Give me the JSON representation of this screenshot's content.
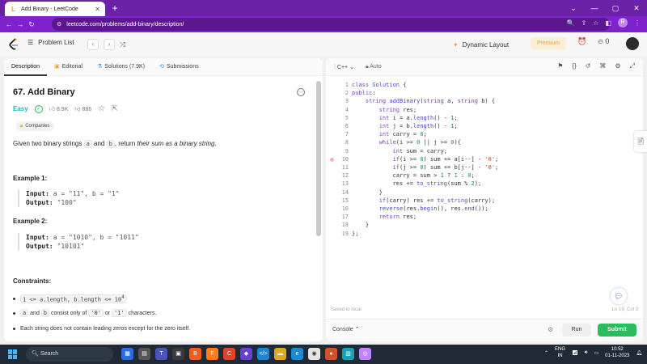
{
  "browser": {
    "tab_title": "Add Binary - LeetCode",
    "url": "leetcode.com/problems/add-binary/description/",
    "profile_initial": "R"
  },
  "header": {
    "problem_list": "Problem List",
    "dynamic_layout": "Dynamic Layout",
    "premium": "Premium",
    "streak": "0"
  },
  "left_tabs": [
    "Description",
    "Editorial",
    "Solutions (7.9K)",
    "Submissions"
  ],
  "problem": {
    "title": "67. Add Binary",
    "difficulty": "Easy",
    "likes": "8.9K",
    "dislikes": "886",
    "companies": "Companies",
    "desc_pre": "Given two binary strings ",
    "desc_a": "a",
    "desc_and": " and ",
    "desc_b": "b",
    "desc_mid": ", return ",
    "desc_em": "their sum as a binary string",
    "desc_end": "."
  },
  "examples": [
    {
      "heading": "Example 1:",
      "input_label": "Input:",
      "input": "a = \"11\", b = \"1\"",
      "output_label": "Output:",
      "output": "\"100\""
    },
    {
      "heading": "Example 2:",
      "input_label": "Input:",
      "input": "a = \"1010\", b = \"1011\"",
      "output_label": "Output:",
      "output": "\"10101\""
    }
  ],
  "constraints": {
    "heading": "Constraints:",
    "c1_code": "1 <= a.length, b.length <= 10",
    "c1_sup": "4",
    "c2_a": "a",
    "c2_and": " and ",
    "c2_b": "b",
    "c2_mid": " consist only of ",
    "c2_0": "'0'",
    "c2_or": " or ",
    "c2_1": "'1'",
    "c2_end": " characters.",
    "c3": "Each string does not contain leading zeros except for the zero itself."
  },
  "editor": {
    "language": "C++",
    "auto": "Auto",
    "saved": "Saved to local",
    "position": "Ln 19, Col 3",
    "console": "Console",
    "run": "Run",
    "submit": "Submit",
    "line_numbers": [
      "1",
      "2",
      "3",
      "4",
      "5",
      "6",
      "7",
      "8",
      "9",
      "10",
      "11",
      "12",
      "13",
      "14",
      "15",
      "16",
      "17",
      "18",
      "19"
    ]
  },
  "taskbar": {
    "search": "Search",
    "lang_top": "ENG",
    "lang_bottom": "IN",
    "time": "10:52",
    "date": "01-11-2023"
  },
  "colors": {
    "browser_purple": "#7e22ce",
    "submit_green": "#2cbb5d",
    "easy_teal": "#1cb8b8",
    "premium_orange": "#f2a024"
  }
}
